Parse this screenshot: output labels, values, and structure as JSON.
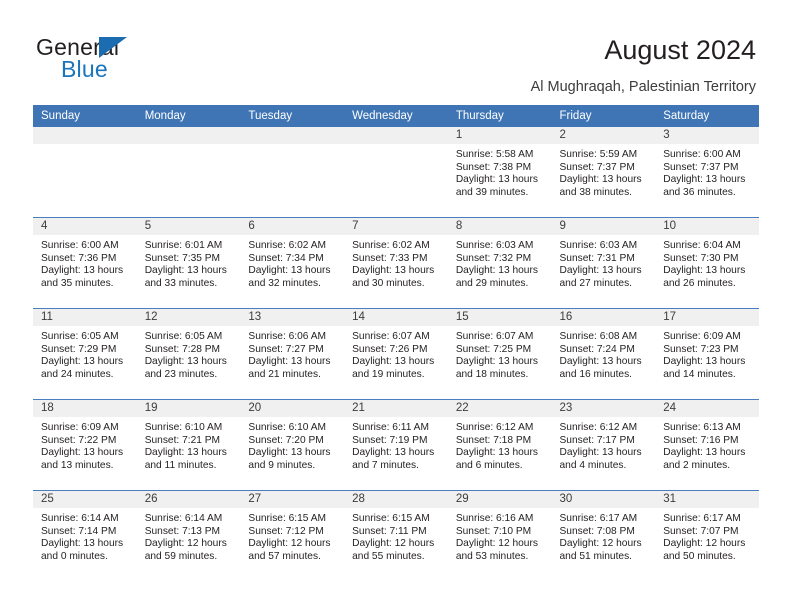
{
  "brand": {
    "name_part1": "General",
    "name_part2": "Blue",
    "triangle_color": "#1b6cb0",
    "blue_color": "#1b75bb"
  },
  "header": {
    "title": "August 2024",
    "subtitle": "Al Mughraqah, Palestinian Territory",
    "accent_color": "#3f75b5",
    "band_color": "#f0f0f0"
  },
  "calendar": {
    "weekday_headers": [
      "Sunday",
      "Monday",
      "Tuesday",
      "Wednesday",
      "Thursday",
      "Friday",
      "Saturday"
    ],
    "labels": {
      "sunrise": "Sunrise:",
      "sunset": "Sunset:",
      "daylight": "Daylight:"
    },
    "weeks": [
      [
        {
          "day": "",
          "empty": true
        },
        {
          "day": "",
          "empty": true
        },
        {
          "day": "",
          "empty": true
        },
        {
          "day": "",
          "empty": true
        },
        {
          "day": "1",
          "sunrise": "Sunrise: 5:58 AM",
          "sunset": "Sunset: 7:38 PM",
          "daylight_1": "Daylight: 13 hours",
          "daylight_2": "and 39 minutes."
        },
        {
          "day": "2",
          "sunrise": "Sunrise: 5:59 AM",
          "sunset": "Sunset: 7:37 PM",
          "daylight_1": "Daylight: 13 hours",
          "daylight_2": "and 38 minutes."
        },
        {
          "day": "3",
          "sunrise": "Sunrise: 6:00 AM",
          "sunset": "Sunset: 7:37 PM",
          "daylight_1": "Daylight: 13 hours",
          "daylight_2": "and 36 minutes."
        }
      ],
      [
        {
          "day": "4",
          "sunrise": "Sunrise: 6:00 AM",
          "sunset": "Sunset: 7:36 PM",
          "daylight_1": "Daylight: 13 hours",
          "daylight_2": "and 35 minutes."
        },
        {
          "day": "5",
          "sunrise": "Sunrise: 6:01 AM",
          "sunset": "Sunset: 7:35 PM",
          "daylight_1": "Daylight: 13 hours",
          "daylight_2": "and 33 minutes."
        },
        {
          "day": "6",
          "sunrise": "Sunrise: 6:02 AM",
          "sunset": "Sunset: 7:34 PM",
          "daylight_1": "Daylight: 13 hours",
          "daylight_2": "and 32 minutes."
        },
        {
          "day": "7",
          "sunrise": "Sunrise: 6:02 AM",
          "sunset": "Sunset: 7:33 PM",
          "daylight_1": "Daylight: 13 hours",
          "daylight_2": "and 30 minutes."
        },
        {
          "day": "8",
          "sunrise": "Sunrise: 6:03 AM",
          "sunset": "Sunset: 7:32 PM",
          "daylight_1": "Daylight: 13 hours",
          "daylight_2": "and 29 minutes."
        },
        {
          "day": "9",
          "sunrise": "Sunrise: 6:03 AM",
          "sunset": "Sunset: 7:31 PM",
          "daylight_1": "Daylight: 13 hours",
          "daylight_2": "and 27 minutes."
        },
        {
          "day": "10",
          "sunrise": "Sunrise: 6:04 AM",
          "sunset": "Sunset: 7:30 PM",
          "daylight_1": "Daylight: 13 hours",
          "daylight_2": "and 26 minutes."
        }
      ],
      [
        {
          "day": "11",
          "sunrise": "Sunrise: 6:05 AM",
          "sunset": "Sunset: 7:29 PM",
          "daylight_1": "Daylight: 13 hours",
          "daylight_2": "and 24 minutes."
        },
        {
          "day": "12",
          "sunrise": "Sunrise: 6:05 AM",
          "sunset": "Sunset: 7:28 PM",
          "daylight_1": "Daylight: 13 hours",
          "daylight_2": "and 23 minutes."
        },
        {
          "day": "13",
          "sunrise": "Sunrise: 6:06 AM",
          "sunset": "Sunset: 7:27 PM",
          "daylight_1": "Daylight: 13 hours",
          "daylight_2": "and 21 minutes."
        },
        {
          "day": "14",
          "sunrise": "Sunrise: 6:07 AM",
          "sunset": "Sunset: 7:26 PM",
          "daylight_1": "Daylight: 13 hours",
          "daylight_2": "and 19 minutes."
        },
        {
          "day": "15",
          "sunrise": "Sunrise: 6:07 AM",
          "sunset": "Sunset: 7:25 PM",
          "daylight_1": "Daylight: 13 hours",
          "daylight_2": "and 18 minutes."
        },
        {
          "day": "16",
          "sunrise": "Sunrise: 6:08 AM",
          "sunset": "Sunset: 7:24 PM",
          "daylight_1": "Daylight: 13 hours",
          "daylight_2": "and 16 minutes."
        },
        {
          "day": "17",
          "sunrise": "Sunrise: 6:09 AM",
          "sunset": "Sunset: 7:23 PM",
          "daylight_1": "Daylight: 13 hours",
          "daylight_2": "and 14 minutes."
        }
      ],
      [
        {
          "day": "18",
          "sunrise": "Sunrise: 6:09 AM",
          "sunset": "Sunset: 7:22 PM",
          "daylight_1": "Daylight: 13 hours",
          "daylight_2": "and 13 minutes."
        },
        {
          "day": "19",
          "sunrise": "Sunrise: 6:10 AM",
          "sunset": "Sunset: 7:21 PM",
          "daylight_1": "Daylight: 13 hours",
          "daylight_2": "and 11 minutes."
        },
        {
          "day": "20",
          "sunrise": "Sunrise: 6:10 AM",
          "sunset": "Sunset: 7:20 PM",
          "daylight_1": "Daylight: 13 hours",
          "daylight_2": "and 9 minutes."
        },
        {
          "day": "21",
          "sunrise": "Sunrise: 6:11 AM",
          "sunset": "Sunset: 7:19 PM",
          "daylight_1": "Daylight: 13 hours",
          "daylight_2": "and 7 minutes."
        },
        {
          "day": "22",
          "sunrise": "Sunrise: 6:12 AM",
          "sunset": "Sunset: 7:18 PM",
          "daylight_1": "Daylight: 13 hours",
          "daylight_2": "and 6 minutes."
        },
        {
          "day": "23",
          "sunrise": "Sunrise: 6:12 AM",
          "sunset": "Sunset: 7:17 PM",
          "daylight_1": "Daylight: 13 hours",
          "daylight_2": "and 4 minutes."
        },
        {
          "day": "24",
          "sunrise": "Sunrise: 6:13 AM",
          "sunset": "Sunset: 7:16 PM",
          "daylight_1": "Daylight: 13 hours",
          "daylight_2": "and 2 minutes."
        }
      ],
      [
        {
          "day": "25",
          "sunrise": "Sunrise: 6:14 AM",
          "sunset": "Sunset: 7:14 PM",
          "daylight_1": "Daylight: 13 hours",
          "daylight_2": "and 0 minutes."
        },
        {
          "day": "26",
          "sunrise": "Sunrise: 6:14 AM",
          "sunset": "Sunset: 7:13 PM",
          "daylight_1": "Daylight: 12 hours",
          "daylight_2": "and 59 minutes."
        },
        {
          "day": "27",
          "sunrise": "Sunrise: 6:15 AM",
          "sunset": "Sunset: 7:12 PM",
          "daylight_1": "Daylight: 12 hours",
          "daylight_2": "and 57 minutes."
        },
        {
          "day": "28",
          "sunrise": "Sunrise: 6:15 AM",
          "sunset": "Sunset: 7:11 PM",
          "daylight_1": "Daylight: 12 hours",
          "daylight_2": "and 55 minutes."
        },
        {
          "day": "29",
          "sunrise": "Sunrise: 6:16 AM",
          "sunset": "Sunset: 7:10 PM",
          "daylight_1": "Daylight: 12 hours",
          "daylight_2": "and 53 minutes."
        },
        {
          "day": "30",
          "sunrise": "Sunrise: 6:17 AM",
          "sunset": "Sunset: 7:08 PM",
          "daylight_1": "Daylight: 12 hours",
          "daylight_2": "and 51 minutes."
        },
        {
          "day": "31",
          "sunrise": "Sunrise: 6:17 AM",
          "sunset": "Sunset: 7:07 PM",
          "daylight_1": "Daylight: 12 hours",
          "daylight_2": "and 50 minutes."
        }
      ]
    ]
  }
}
